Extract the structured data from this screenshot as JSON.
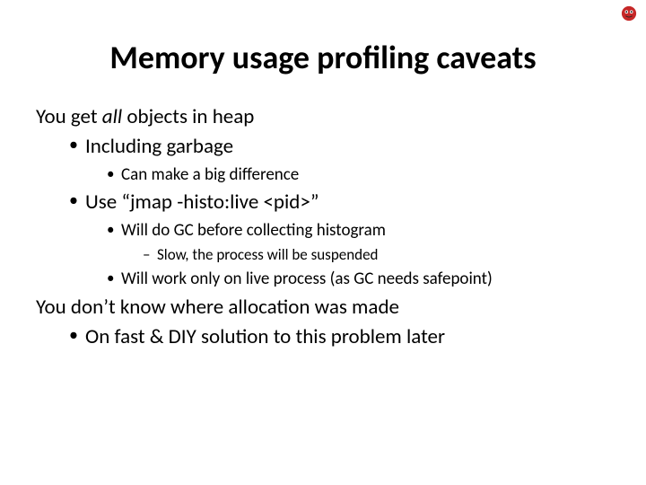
{
  "slide": {
    "title": "Memory usage profiling caveats",
    "lines": {
      "l0a_pre": "You get ",
      "l0a_em": "all",
      "l0a_post": " objects in heap",
      "l1a": "Including garbage",
      "l2a": "Can make a big difference",
      "l1b": "Use “jmap -histo:live <pid>”",
      "l2b": "Will do GC before collecting histogram",
      "l3a": "Slow, the process will be suspended",
      "l2c": "Will work only on live process (as GC needs safepoint)",
      "l0b": "You don’t know where allocation was made",
      "l1c": "On fast & DIY solution to this problem later"
    }
  }
}
